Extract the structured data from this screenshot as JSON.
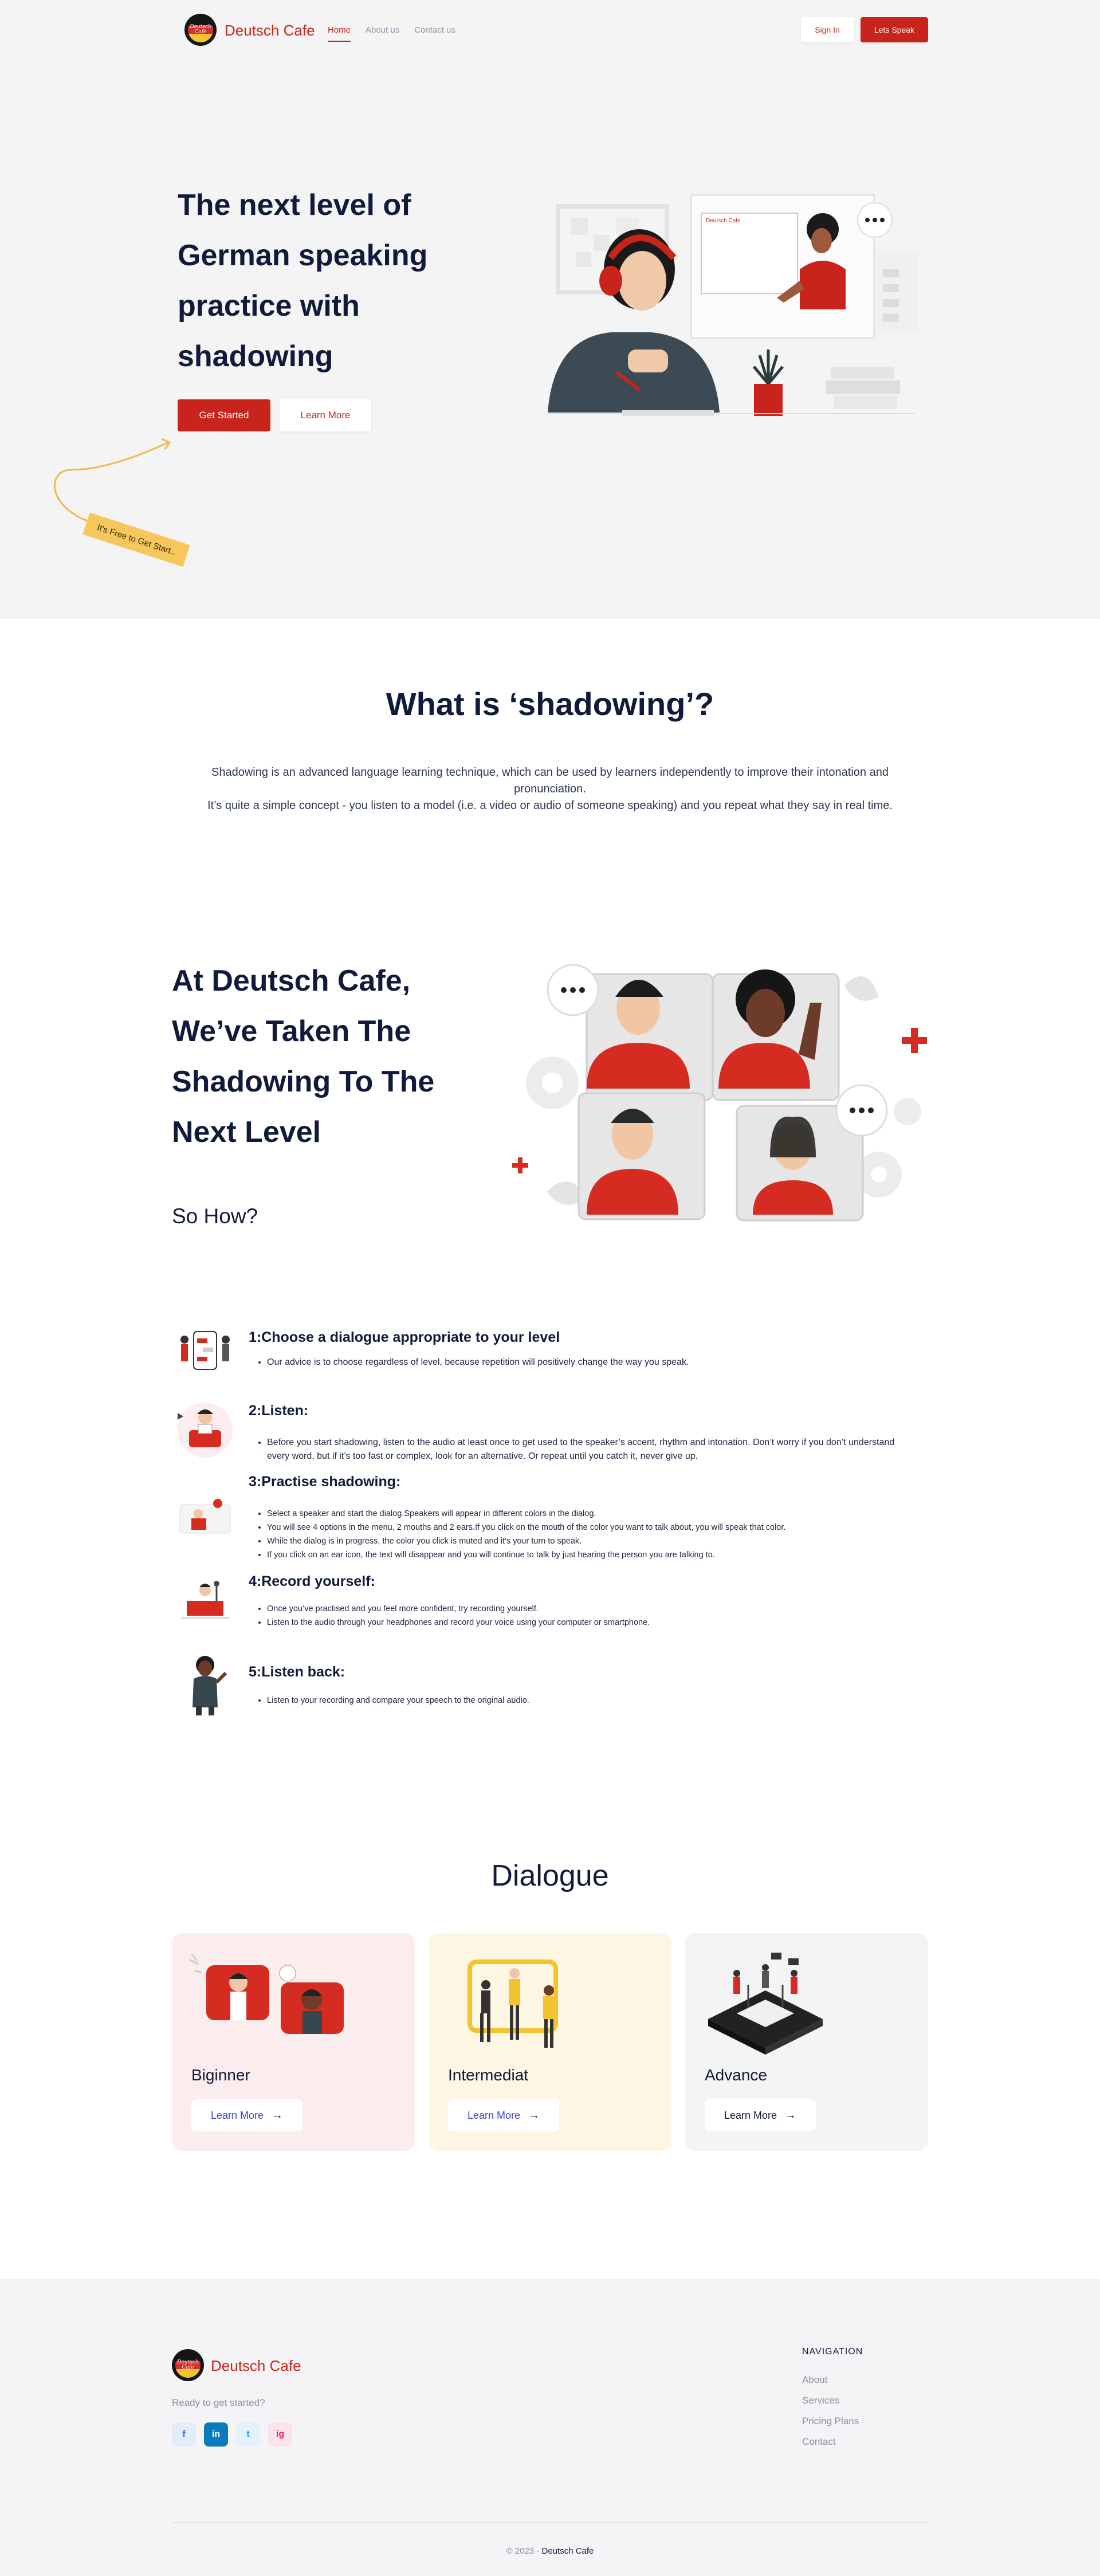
{
  "nav": {
    "brand": "Deutsch Cafe",
    "logo_text": "Deutsch Cafe",
    "links": [
      "Home",
      "About us",
      "Contact us"
    ],
    "sign_in": "Sign In",
    "lets_speak": "Lets Speak"
  },
  "hero": {
    "title_lines": [
      "The next level of",
      "German speaking",
      "practice with",
      "shadowing"
    ],
    "get_started": "Get Started",
    "learn_more": "Learn More",
    "tag": "It's Free to Get Start..",
    "illustration_screen_text": "Deutsch Cafe"
  },
  "what": {
    "title": "What is ‘shadowing’?",
    "para1": "Shadowing is an advanced language learning technique, which can be used by learners independently to improve their intonation and pronunciation.",
    "para2": "It’s quite a simple concept - you listen to a model (i.e. a video or audio of someone speaking) and you repeat what they say in real time."
  },
  "level": {
    "title_lines": [
      "At Deutsch Cafe,",
      "We’ve Taken The",
      "Shadowing To The",
      "Next Level"
    ],
    "so_how": "So How?"
  },
  "steps": [
    {
      "title": "1:Choose a dialogue appropriate to your level",
      "bullets": [
        "Our advice is to choose regardless of level, because repetition will positively change the way you speak."
      ]
    },
    {
      "title": "2:Listen:",
      "bullets": [
        "Before you start shadowing, listen to the audio at least once to get used to the speaker’s accent, rhythm and intonation. Don’t worry if you don’t understand every word, but if it’s too fast or complex, look for an alternative. Or repeat until you catch it, never give up."
      ]
    },
    {
      "title": "3:Practise shadowing:",
      "bullets": [
        "Select a speaker and start the dialog.Speakers will appear in different colors in the dialog.",
        "You will see 4 options in the menu, 2 mouths and 2 ears.If you click on the mouth of the color you want to talk about, you will speak that color.",
        "While the dialog is in progress, the color you click is muted and it's your turn to speak.",
        "If you click on an ear icon, the text will disappear and you will continue to talk by just hearing the person you are talking to."
      ]
    },
    {
      "title": "4:Record yourself:",
      "bullets": [
        "Once you’ve practised and you feel more confident, try recording yourself.",
        "Listen to the audio through your headphones and record your voice using your computer or smartphone."
      ]
    },
    {
      "title": "5:Listen back:",
      "bullets": [
        "Listen to your recording and compare your speech to the original audio."
      ]
    }
  ],
  "dialogue": {
    "title": "Dialogue",
    "cards": [
      {
        "level": "Biginner",
        "button": "Learn More",
        "bg": "#fbeced",
        "btn_color": "#3b3fd8"
      },
      {
        "level": "Intermediat",
        "button": "Learn More",
        "bg": "#fdf6e3",
        "btn_color": "#3b3fd8"
      },
      {
        "level": "Advance",
        "button": "Learn More",
        "bg": "#f4f4f4",
        "btn_color": "#101a3a"
      }
    ]
  },
  "footer": {
    "brand": "Deutsch Cafe",
    "tagline": "Ready to get started?",
    "social": [
      "f",
      "in",
      "t",
      "ig"
    ],
    "nav_title": "NAVIGATION",
    "nav_links": [
      "About",
      "Services",
      "Pricing Plans",
      "Contact"
    ],
    "copyright_prefix": "© 2023 -",
    "copyright_brand": "Deutsch Cafe"
  },
  "colors": {
    "accent": "#c8241c",
    "navy": "#101a3a",
    "hero_bg": "#f4f4f5",
    "footer_bg": "#f4f4f6"
  }
}
